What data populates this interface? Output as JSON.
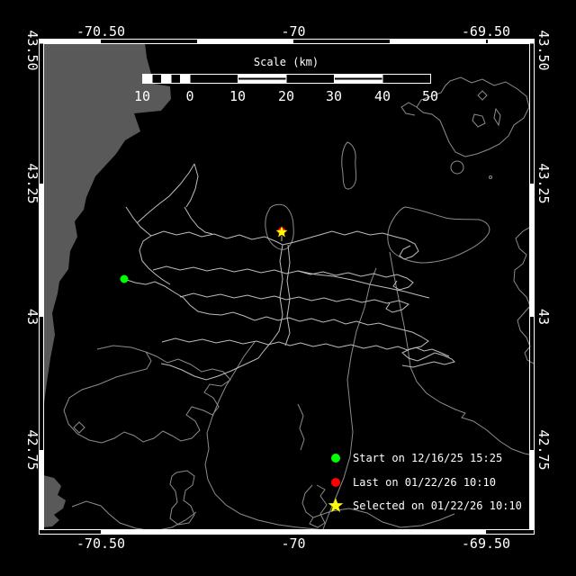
{
  "axis": {
    "top": [
      "-70.50",
      "-70",
      "-69.50"
    ],
    "bottom": [
      "-70.50",
      "-70",
      "-69.50"
    ],
    "left": [
      "43.50",
      "43.25",
      "43",
      "42.75"
    ],
    "right": [
      "43.50",
      "43.25",
      "43",
      "42.75"
    ]
  },
  "scale_bar": {
    "title": "Scale (km)",
    "ticks": [
      "10",
      "0",
      "10",
      "20",
      "30",
      "40",
      "50"
    ]
  },
  "legend": {
    "items": [
      {
        "marker": "green-dot",
        "color": "#00ff00",
        "label": "Start on 12/16/25 15:25"
      },
      {
        "marker": "red-dot",
        "color": "#ff0000",
        "label": "Last on 01/22/26 10:10"
      },
      {
        "marker": "yellow-star",
        "color": "#ffff00",
        "label": "Selected on 01/22/26 10:10"
      }
    ]
  },
  "markers": {
    "start": {
      "color": "#00ff00"
    },
    "last": {
      "color": "#ff0000"
    },
    "selected": {
      "color": "#ffff00"
    }
  },
  "colors": {
    "background": "#000000",
    "land": "#595959",
    "coastline": "#8c8c8c",
    "track": "#bdbdbd",
    "frame": "#ffffff",
    "text": "#ffffff"
  }
}
